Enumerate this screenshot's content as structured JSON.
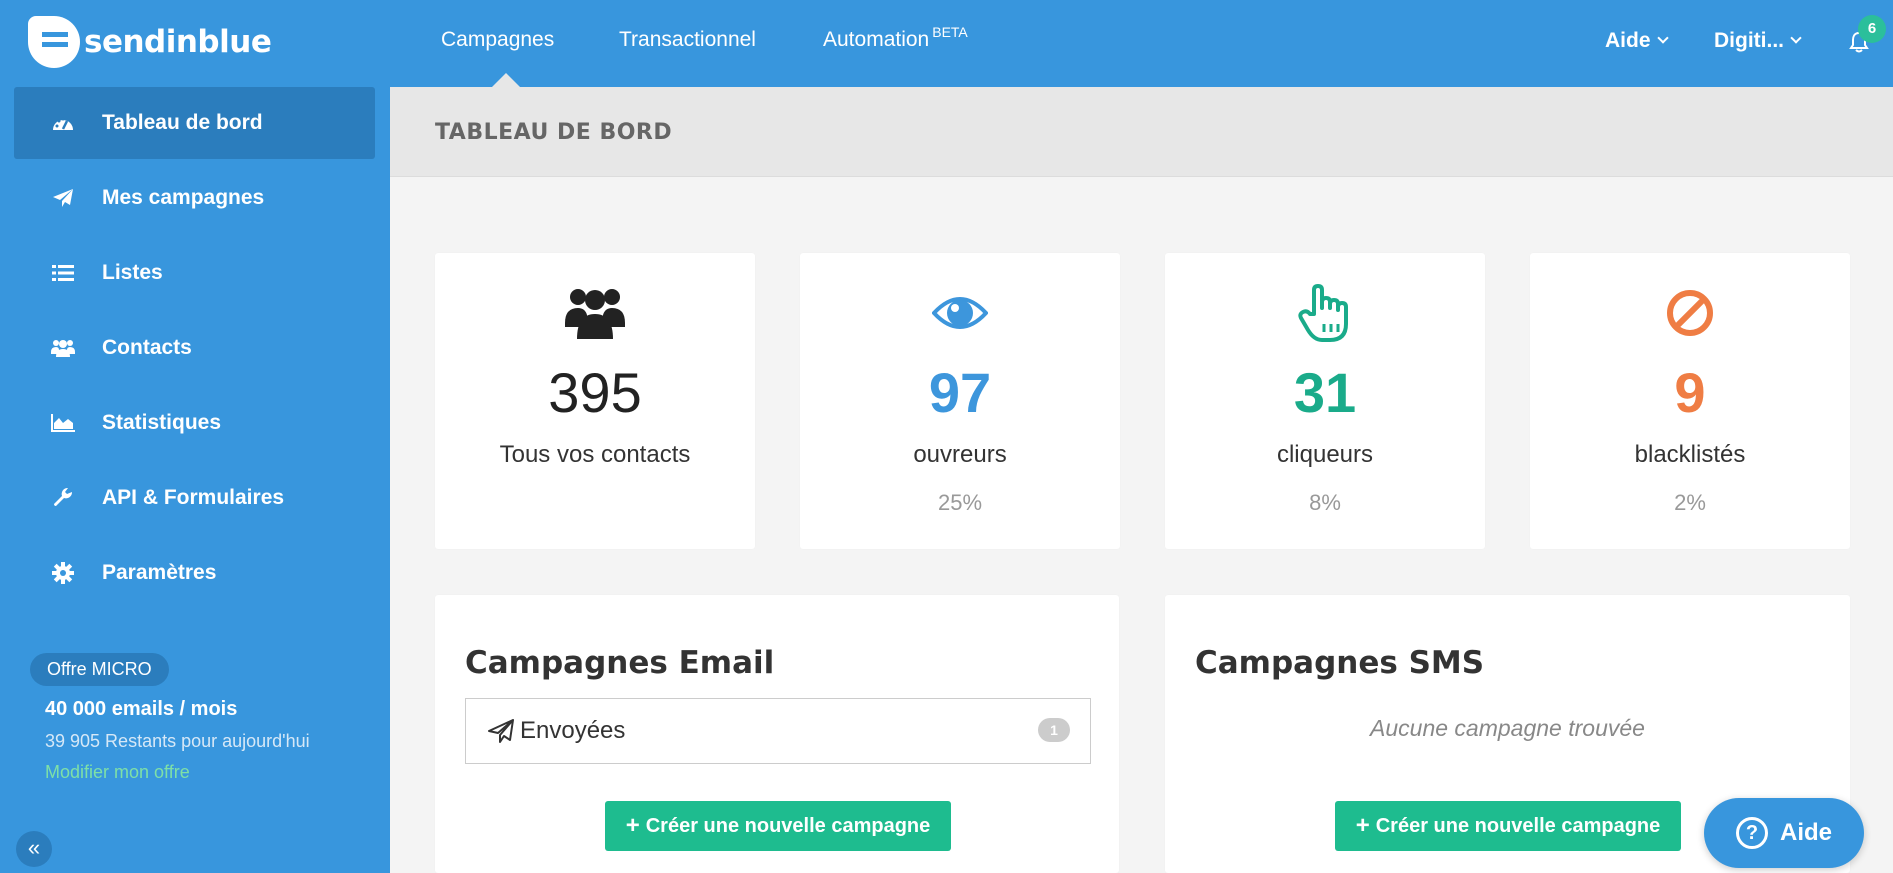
{
  "brand": {
    "name": "sendinblue"
  },
  "nav": {
    "items": [
      {
        "label": "Campagnes"
      },
      {
        "label": "Transactionnel"
      },
      {
        "label": "Automation",
        "sup": "BETA"
      }
    ],
    "help_label": "Aide",
    "account_label": "Digiti...",
    "notification_count": "6"
  },
  "sidebar": {
    "items": [
      {
        "label": "Tableau de bord",
        "icon": "dashboard-icon"
      },
      {
        "label": "Mes campagnes",
        "icon": "paper-plane-icon"
      },
      {
        "label": "Listes",
        "icon": "list-icon"
      },
      {
        "label": "Contacts",
        "icon": "users-icon"
      },
      {
        "label": "Statistiques",
        "icon": "area-chart-icon"
      },
      {
        "label": "API & Formulaires",
        "icon": "wrench-icon"
      },
      {
        "label": "Paramètres",
        "icon": "gear-icon"
      }
    ],
    "offer": {
      "badge": "Offre MICRO",
      "title": "40 000 emails / mois",
      "remaining": "39 905 Restants pour aujourd'hui",
      "link": "Modifier mon offre"
    }
  },
  "page": {
    "title": "TABLEAU DE BORD"
  },
  "stats": [
    {
      "value": "395",
      "label": "Tous vos contacts",
      "pct": "",
      "color": "#222222",
      "icon": "users-icon"
    },
    {
      "value": "97",
      "label": "ouvreurs",
      "pct": "25%",
      "color": "#3d96dc",
      "icon": "eye-icon"
    },
    {
      "value": "31",
      "label": "cliqueurs",
      "pct": "8%",
      "color": "#1aab8a",
      "icon": "pointer-hand-icon"
    },
    {
      "value": "9",
      "label": "blacklistés",
      "pct": "2%",
      "color": "#ef7d44",
      "icon": "ban-icon"
    }
  ],
  "email_panel": {
    "title": "Campagnes Email",
    "sent_label": "Envoyées",
    "sent_count": "1",
    "create_label": "Créer une nouvelle campagne"
  },
  "sms_panel": {
    "title": "Campagnes SMS",
    "empty": "Aucune campagne trouvée",
    "create_label": "Créer une nouvelle campagne"
  },
  "help_widget": {
    "label": "Aide"
  },
  "colors": {
    "primary": "#3896dd",
    "sidebar_active": "#2b7dbd",
    "green": "#1ebc8f"
  }
}
